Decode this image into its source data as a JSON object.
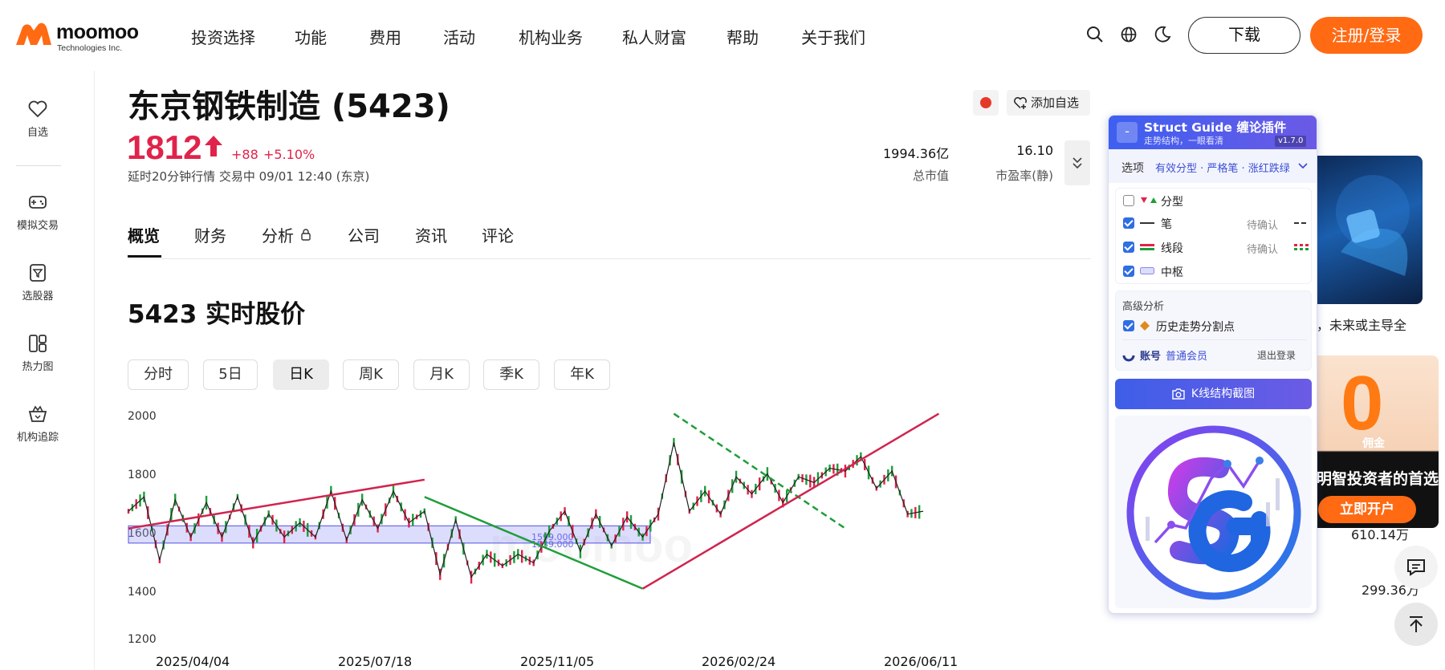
{
  "brand": {
    "name": "moomoo",
    "sub": "Technologies Inc.",
    "color": "#ff6a13"
  },
  "nav": {
    "items": [
      "投资选择",
      "功能",
      "费用",
      "活动",
      "机构业务",
      "私人财富",
      "帮助",
      "关于我们"
    ],
    "icons": [
      "search-icon",
      "globe-icon",
      "moon-icon"
    ],
    "download_label": "下载",
    "register_label": "注册/登录"
  },
  "sidebar": {
    "items": [
      {
        "label": "自选",
        "icon": "heart-icon"
      },
      {
        "label": "模拟交易",
        "icon": "gamepad-icon"
      },
      {
        "label": "选股器",
        "icon": "filter-icon"
      },
      {
        "label": "热力图",
        "icon": "heatmap-icon"
      },
      {
        "label": "机构追踪",
        "icon": "crown-basket-icon"
      }
    ]
  },
  "stock": {
    "name": "东京钢铁制造 (5423)",
    "price": "1812",
    "change_abs": "+88",
    "change_pct": "+5.10%",
    "delay_info": "延时20分钟行情  交易中 09/01 12:40 (东京)",
    "market_cap_value": "1994.36亿",
    "market_cap_label": "总市值",
    "pe_value": "16.10",
    "pe_label": "市盈率(静)",
    "watch_label": "添加自选",
    "up_color": "#e0234a"
  },
  "tabs": [
    "概览",
    "财务",
    "分析",
    "公司",
    "资讯",
    "评论"
  ],
  "section_title": "5423 实时股价",
  "periods": [
    "分时",
    "5日",
    "日K",
    "周K",
    "月K",
    "季K",
    "年K"
  ],
  "active_period": "日K",
  "chart_data": {
    "type": "line",
    "ylim": [
      1200,
      2000
    ],
    "y_ticks": [
      "2000",
      "1800",
      "1600",
      "1400",
      "1200"
    ],
    "x_ticks": [
      "2025/04/04",
      "2025/07/18",
      "2025/11/05",
      "2026/02/24",
      "2026/06/11"
    ],
    "zone_labels": [
      "1599.000",
      "1539.000"
    ],
    "zone": [
      1539,
      1599
    ],
    "watermark": "moomoo",
    "series": [
      {
        "values": [
          1650,
          1700,
          1480,
          1690,
          1560,
          1680,
          1560,
          1700,
          1540,
          1640,
          1560,
          1610,
          1560,
          1720,
          1550,
          1690,
          1590,
          1720,
          1610,
          1650,
          1430,
          1620,
          1420,
          1500,
          1460,
          1500,
          1470,
          1580,
          1650,
          1510,
          1640,
          1530,
          1630,
          1560,
          1640,
          1890,
          1650,
          1720,
          1640,
          1770,
          1710,
          1780,
          1680,
          1770,
          1750,
          1800,
          1790,
          1840,
          1730,
          1790,
          1640,
          1650
        ]
      },
      {
        "values": [
          1590,
          1700,
          1760
        ]
      },
      {
        "values": [
          1700,
          1380,
          1990,
          1610
        ]
      },
      {
        "values": [
          1990,
          1590
        ]
      }
    ]
  },
  "ads": {
    "ad1_caption": "，未来或主导全",
    "ad2_zero": "0",
    "ad2_commission": "佣金",
    "ad2_line": "明智投资者的首选",
    "ad2_button": "立即开户",
    "num1": "610.14万",
    "num2": "299.36万"
  },
  "plugin": {
    "title": "Struct Guide 缠论插件",
    "subtitle": "走势结构，一眼看清",
    "version": "v1.7.0",
    "minus": "-",
    "option_label": "选项",
    "option_value": "有效分型 · 严格笔 · 涨红跌绿",
    "rows": [
      {
        "label": "分型",
        "checked": false,
        "pending": ""
      },
      {
        "label": "笔",
        "checked": true,
        "pending": "待确认"
      },
      {
        "label": "线段",
        "checked": true,
        "pending": "待确认"
      },
      {
        "label": "中枢",
        "checked": true,
        "pending": ""
      }
    ],
    "advanced_title": "高级分析",
    "advanced_row": "历史走势分割点",
    "account_label": "账号",
    "account_level": "普通会员",
    "logout": "退出登录",
    "screenshot_btn": "K线结构截图",
    "accent": "#3d5ff0"
  }
}
